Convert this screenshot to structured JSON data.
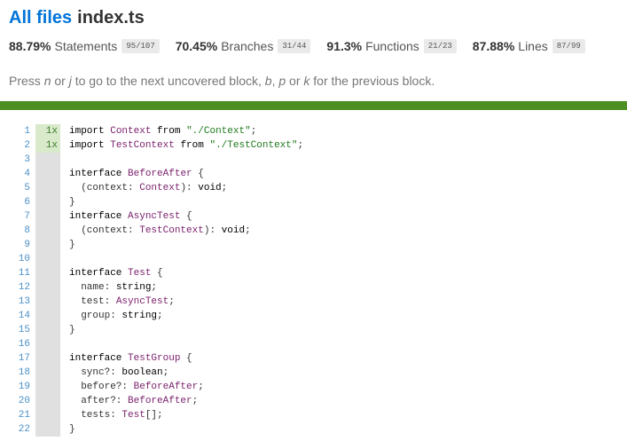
{
  "header": {
    "breadcrumb_link": "All files",
    "file_name": "index.ts"
  },
  "stats": [
    {
      "pct": "88.79%",
      "label": "Statements",
      "fraction": "95/107"
    },
    {
      "pct": "70.45%",
      "label": "Branches",
      "fraction": "31/44"
    },
    {
      "pct": "91.3%",
      "label": "Functions",
      "fraction": "21/23"
    },
    {
      "pct": "87.88%",
      "label": "Lines",
      "fraction": "87/99"
    }
  ],
  "hint": {
    "press": "Press",
    "key_n": "n",
    "or1": "or",
    "key_j": "j",
    "next_text": "to go to the next uncovered block,",
    "key_b": "b",
    "comma": ",",
    "key_p": "p",
    "or2": "or",
    "key_k": "k",
    "prev_text": "for the previous block."
  },
  "colors": {
    "link": "#0074d9",
    "coverage_bar": "#4d8f22",
    "line_number": "#4a8fc6",
    "covered_hits_bg": "#d8eaca"
  },
  "code_lines": [
    {
      "n": "1",
      "hits": "1x",
      "text": "import Context from \"./Context\";"
    },
    {
      "n": "2",
      "hits": "1x",
      "text": "import TestContext from \"./TestContext\";"
    },
    {
      "n": "3",
      "hits": "",
      "text": ""
    },
    {
      "n": "4",
      "hits": "",
      "text": "interface BeforeAfter {"
    },
    {
      "n": "5",
      "hits": "",
      "text": "  (context: Context): void;"
    },
    {
      "n": "6",
      "hits": "",
      "text": "}"
    },
    {
      "n": "7",
      "hits": "",
      "text": "interface AsyncTest {"
    },
    {
      "n": "8",
      "hits": "",
      "text": "  (context: TestContext): void;"
    },
    {
      "n": "9",
      "hits": "",
      "text": "}"
    },
    {
      "n": "10",
      "hits": "",
      "text": ""
    },
    {
      "n": "11",
      "hits": "",
      "text": "interface Test {"
    },
    {
      "n": "12",
      "hits": "",
      "text": "  name: string;"
    },
    {
      "n": "13",
      "hits": "",
      "text": "  test: AsyncTest;"
    },
    {
      "n": "14",
      "hits": "",
      "text": "  group: string;"
    },
    {
      "n": "15",
      "hits": "",
      "text": "}"
    },
    {
      "n": "16",
      "hits": "",
      "text": ""
    },
    {
      "n": "17",
      "hits": "",
      "text": "interface TestGroup {"
    },
    {
      "n": "18",
      "hits": "",
      "text": "  sync?: boolean;"
    },
    {
      "n": "19",
      "hits": "",
      "text": "  before?: BeforeAfter;"
    },
    {
      "n": "20",
      "hits": "",
      "text": "  after?: BeforeAfter;"
    },
    {
      "n": "21",
      "hits": "",
      "text": "  tests: Test[];"
    },
    {
      "n": "22",
      "hits": "",
      "text": "}"
    }
  ]
}
